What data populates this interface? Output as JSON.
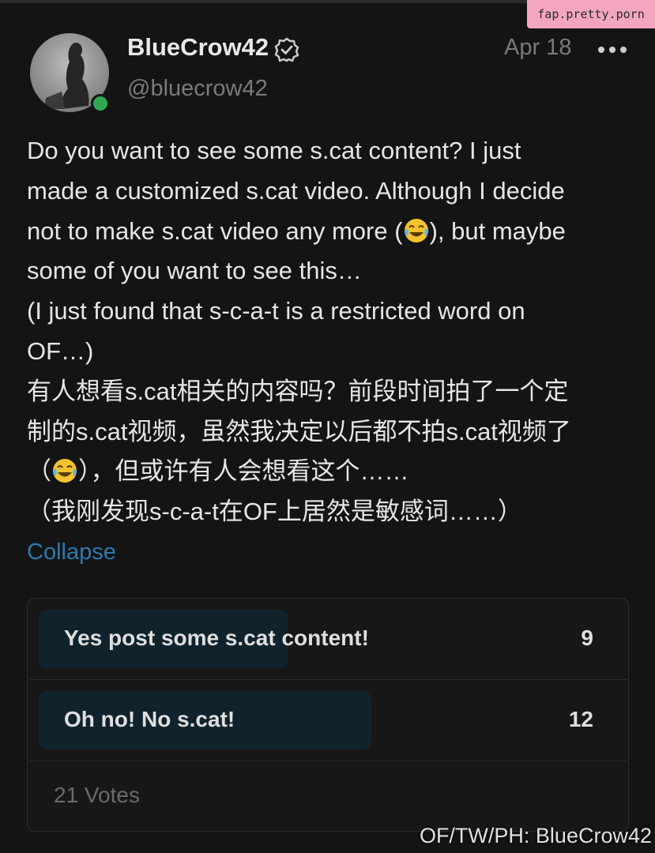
{
  "watermark": "fap.pretty.porn",
  "post": {
    "display_name": "BlueCrow42",
    "username": "@bluecrow42",
    "date": "Apr 18",
    "body_lines": [
      "Do you want to see some s.cat content? I just",
      "made a customized s.cat video. Although I decide",
      "not to make s.cat video any more (",
      "), but maybe",
      "some of you want to see this…",
      "(I just found that s-c-a-t is a restricted word on",
      "OF…)",
      "有人想看s.cat相关的内容吗？前段时间拍了一个定",
      "制的s.cat视频，虽然我决定以后都不拍s.cat视频了",
      "（",
      "），但或许有人会想看这个……",
      "（我刚发现s-c-a-t在OF上居然是敏感词……）"
    ],
    "collapse_label": "Collapse"
  },
  "poll": {
    "options": [
      {
        "label": "Yes post some s.cat content!",
        "count": "9",
        "fraction": 0.4286
      },
      {
        "label": "Oh no! No s.cat!",
        "count": "12",
        "fraction": 0.5714
      }
    ],
    "votes_label": "21 Votes"
  },
  "credit": "OF/TW/PH: BlueCrow42",
  "colors": {
    "background": "#141414",
    "link": "#2f79ad",
    "online": "#2fa84f",
    "poll_fill": "#10232d",
    "watermark_bg": "#f4a6c0"
  },
  "icons": {
    "verified": "verified-badge-icon",
    "more": "more-options-icon",
    "emoji": "tears-of-joy-emoji-icon"
  }
}
